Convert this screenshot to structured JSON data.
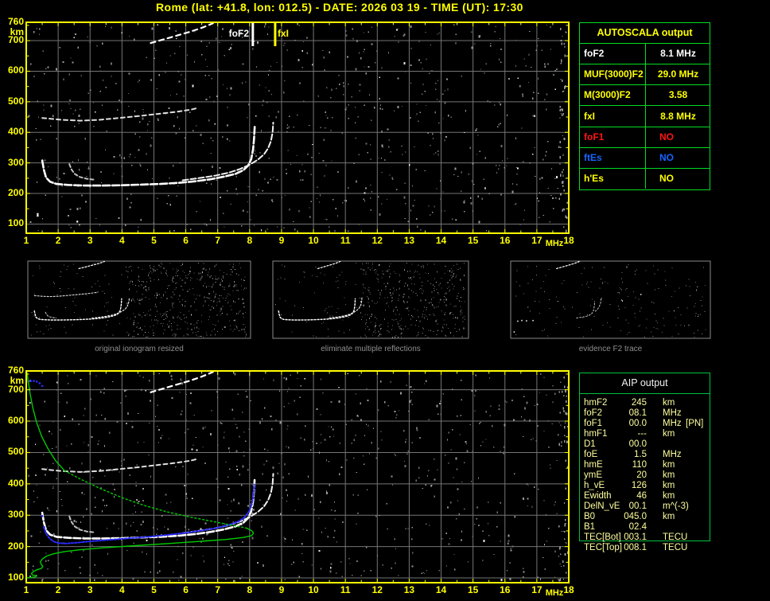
{
  "title": "Rome (lat: +41.8, lon: 012.5) - DATE: 2026 03 19 - TIME (UT): 17:30",
  "colors": {
    "accent_yellow": "#ffff00",
    "grid_gray": "#757575",
    "trace_white": "#ffffff",
    "profile_green": "#00cc00",
    "fit_blue": "#2a2aff",
    "table_green": "#00dd22",
    "aip_green": "#00c040",
    "aip_text": "#ffff9e",
    "caption_gray": "#8f8f8f",
    "alert_red": "#ff1414",
    "alert_blue": "#1565ff"
  },
  "markers": {
    "foF2_label": "foF2",
    "foF2_mhz": 8.1,
    "fxI_label": "fxI",
    "fxI_mhz": 8.8
  },
  "axis": {
    "x_labels": [
      "1",
      "2",
      "3",
      "4",
      "5",
      "6",
      "7",
      "8",
      "9",
      "10",
      "11",
      "12",
      "13",
      "14",
      "15",
      "16",
      "17",
      "18"
    ],
    "x_unit": "MHz",
    "y_labels": [
      "760",
      "km",
      "700",
      "600",
      "500",
      "400",
      "300",
      "200",
      "100"
    ]
  },
  "autoscala_table": {
    "header": "AUTOSCALA output",
    "rows": [
      {
        "label": "foF2",
        "value": "8.1 MHz",
        "color": "#ffffff",
        "value_align": "center"
      },
      {
        "label": "MUF(3000)F2",
        "value": "29.0 MHz",
        "color": "#ffff00",
        "value_align": "center"
      },
      {
        "label": "M(3000)F2",
        "value": "3.58",
        "color": "#ffff00",
        "value_align": "center"
      },
      {
        "label": "fxI",
        "value": "8.8 MHz",
        "color": "#ffff00",
        "value_align": "center"
      },
      {
        "label": "foF1",
        "value": "NO",
        "color": "#ff1414",
        "value_align": "left"
      },
      {
        "label": "ftEs",
        "value": "NO",
        "color": "#1565ff",
        "value_align": "left"
      },
      {
        "label": "h'Es",
        "value": "NO",
        "color": "#ffff00",
        "value_align": "left"
      }
    ]
  },
  "aip_table": {
    "header": "AIP output",
    "rows": [
      {
        "label": "hmF2",
        "value": "245",
        "unit": "km",
        "note": ""
      },
      {
        "label": "foF2",
        "value": "08.1",
        "unit": "MHz",
        "note": ""
      },
      {
        "label": "foF1",
        "value": "00.0",
        "unit": "MHz",
        "note": "[PN]"
      },
      {
        "label": "hmF1",
        "value": "---",
        "unit": "km",
        "note": ""
      },
      {
        "label": "D1",
        "value": "00.0",
        "unit": "",
        "note": ""
      },
      {
        "label": "foE",
        "value": "1.5",
        "unit": "MHz",
        "note": ""
      },
      {
        "label": "hmE",
        "value": "110",
        "unit": "km",
        "note": ""
      },
      {
        "label": "ymE",
        "value": "20",
        "unit": "km",
        "note": ""
      },
      {
        "label": "h_vE",
        "value": "126",
        "unit": "km",
        "note": ""
      },
      {
        "label": "Ewidth",
        "value": "46",
        "unit": "km",
        "note": ""
      },
      {
        "label": "DelN_vE",
        "value": "00.1",
        "unit": "m^(-3)",
        "note": ""
      },
      {
        "label": "B0",
        "value": "045.0",
        "unit": "km",
        "note": ""
      },
      {
        "label": "B1",
        "value": "02.4",
        "unit": "",
        "note": ""
      },
      {
        "label": "TEC[Bot]",
        "value": "003.1",
        "unit": "TECU",
        "note": ""
      },
      {
        "label": "TEC[Top]",
        "value": "008.1",
        "unit": "TECU",
        "note": ""
      }
    ]
  },
  "thumbnails": [
    {
      "caption": "original ionogram resized"
    },
    {
      "caption": "eliminate multiple reflections"
    },
    {
      "caption": "evidence F2 trace"
    }
  ],
  "chart_data": {
    "type": "scatter",
    "charts": [
      {
        "name": "autoscala_scaled_ionogram",
        "xlabel": "MHz",
        "ylabel": "km",
        "xlim": [
          1,
          18
        ],
        "ylim": [
          70,
          760
        ],
        "x_ticks": [
          1,
          2,
          3,
          4,
          5,
          6,
          7,
          8,
          9,
          10,
          11,
          12,
          13,
          14,
          15,
          16,
          17,
          18
        ],
        "y_ticks": [
          100,
          200,
          300,
          400,
          500,
          600,
          700,
          760
        ],
        "grid": true,
        "markers": [
          {
            "label": "foF2",
            "x_mhz": 8.1
          },
          {
            "label": "fxI",
            "x_mhz": 8.8
          }
        ],
        "traces": [
          "F2_O_trace",
          "F2_left_arc",
          "F2_X_trace",
          "second_reflection",
          "oblique_trace",
          "stray_dots"
        ]
      },
      {
        "name": "aip_ionogram_with_profile",
        "xlabel": "MHz",
        "ylabel": "km",
        "xlim": [
          1,
          18
        ],
        "ylim": [
          70,
          760
        ],
        "x_ticks": [
          1,
          2,
          3,
          4,
          5,
          6,
          7,
          8,
          9,
          10,
          11,
          12,
          13,
          14,
          15,
          16,
          17,
          18
        ],
        "y_ticks": [
          100,
          200,
          300,
          400,
          500,
          600,
          700,
          760
        ],
        "grid": true,
        "markers": [],
        "traces": [
          "F2_O_trace",
          "F2_left_arc",
          "F2_X_trace",
          "second_reflection",
          "oblique_trace",
          "fitted_trace",
          "fitted_E_dots",
          "profile_topside_solid",
          "profile_topside_dotted",
          "profile_bottomside"
        ]
      }
    ],
    "trace_library": {
      "F2_O_trace": {
        "color": "#ffffff",
        "width": 2.6,
        "dash": "9,3",
        "points_mhz_km": [
          [
            1.5,
            308
          ],
          [
            1.55,
            278
          ],
          [
            1.62,
            252
          ],
          [
            1.75,
            238
          ],
          [
            1.95,
            231
          ],
          [
            2.3,
            228
          ],
          [
            2.8,
            226
          ],
          [
            3.4,
            226
          ],
          [
            4.0,
            227
          ],
          [
            4.6,
            229
          ],
          [
            5.2,
            231
          ],
          [
            5.8,
            235
          ],
          [
            6.3,
            240
          ],
          [
            6.8,
            247
          ],
          [
            7.2,
            255
          ],
          [
            7.55,
            264
          ],
          [
            7.8,
            276
          ],
          [
            7.95,
            291
          ],
          [
            8.05,
            312
          ],
          [
            8.11,
            345
          ],
          [
            8.14,
            380
          ],
          [
            8.16,
            418
          ]
        ]
      },
      "F2_left_arc": {
        "color": "#c0c0c0",
        "width": 2,
        "dash": "4,3",
        "points_mhz_km": [
          [
            2.35,
            296
          ],
          [
            2.42,
            278
          ],
          [
            2.52,
            264
          ],
          [
            2.68,
            254
          ],
          [
            2.9,
            248
          ],
          [
            3.15,
            245
          ]
        ]
      },
      "F2_X_trace": {
        "color": "#f2f2f2",
        "width": 2,
        "dash": "7,3",
        "points_mhz_km": [
          [
            5.9,
            243
          ],
          [
            6.4,
            250
          ],
          [
            6.9,
            258
          ],
          [
            7.35,
            268
          ],
          [
            7.7,
            280
          ],
          [
            8.0,
            294
          ],
          [
            8.25,
            310
          ],
          [
            8.45,
            328
          ],
          [
            8.58,
            348
          ],
          [
            8.67,
            372
          ],
          [
            8.72,
            400
          ],
          [
            8.74,
            432
          ]
        ]
      },
      "second_reflection": {
        "color": "#dedede",
        "width": 2,
        "dash": "5,4",
        "points_mhz_km": [
          [
            1.5,
            447
          ],
          [
            2.1,
            441
          ],
          [
            2.7,
            438
          ],
          [
            3.3,
            441
          ],
          [
            3.9,
            447
          ],
          [
            4.5,
            453
          ],
          [
            5.1,
            460
          ],
          [
            5.7,
            467
          ],
          [
            6.15,
            474
          ],
          [
            6.35,
            479
          ]
        ]
      },
      "oblique_trace": {
        "color": "#ffffff",
        "width": 2.2,
        "dash": "6,5",
        "points_mhz_km": [
          [
            4.9,
            692
          ],
          [
            5.3,
            704
          ],
          [
            5.7,
            716
          ],
          [
            6.1,
            728
          ],
          [
            6.45,
            740
          ],
          [
            6.7,
            750
          ],
          [
            6.85,
            757
          ]
        ]
      },
      "profile_topside_solid": {
        "color": "#00cc00",
        "width": 1.4,
        "dash": "",
        "points_mhz_km": [
          [
            1.02,
            758
          ],
          [
            1.06,
            728
          ],
          [
            1.12,
            688
          ],
          [
            1.2,
            645
          ],
          [
            1.32,
            598
          ],
          [
            1.48,
            552
          ],
          [
            1.68,
            512
          ],
          [
            1.92,
            474
          ],
          [
            2.2,
            442
          ]
        ]
      },
      "profile_topside_dotted": {
        "color": "#00cc00",
        "width": 1.4,
        "dash": "2,3",
        "points_mhz_km": [
          [
            2.2,
            442
          ],
          [
            2.7,
            415
          ],
          [
            3.3,
            386
          ],
          [
            4.0,
            356
          ],
          [
            4.7,
            331
          ],
          [
            5.4,
            311
          ],
          [
            6.1,
            295
          ],
          [
            6.8,
            281
          ],
          [
            7.4,
            269
          ],
          [
            7.9,
            259
          ]
        ]
      },
      "profile_bottomside": {
        "color": "#00cc00",
        "width": 1.4,
        "dash": "",
        "points_mhz_km": [
          [
            7.9,
            259
          ],
          [
            8.07,
            250
          ],
          [
            8.12,
            243
          ],
          [
            8.06,
            235
          ],
          [
            7.8,
            229
          ],
          [
            7.3,
            223
          ],
          [
            6.5,
            217
          ],
          [
            5.5,
            210
          ],
          [
            4.4,
            203
          ],
          [
            3.4,
            196
          ],
          [
            2.7,
            190
          ],
          [
            2.2,
            184
          ],
          [
            1.85,
            177
          ],
          [
            1.62,
            169
          ],
          [
            1.5,
            160
          ],
          [
            1.44,
            151
          ],
          [
            1.47,
            143
          ],
          [
            1.52,
            137
          ],
          [
            1.47,
            130
          ],
          [
            1.33,
            126
          ],
          [
            1.22,
            120
          ],
          [
            1.16,
            114
          ],
          [
            1.2,
            109
          ],
          [
            1.32,
            107
          ],
          [
            1.28,
            103
          ],
          [
            1.12,
            101
          ],
          [
            1.04,
            100
          ]
        ]
      },
      "fitted_trace": {
        "color": "#2a2aff",
        "width": 2,
        "dash": "2.5,2",
        "points_mhz_km": [
          [
            1.55,
            262
          ],
          [
            1.63,
            240
          ],
          [
            1.73,
            226
          ],
          [
            1.86,
            216
          ],
          [
            2.02,
            211
          ],
          [
            2.25,
            210
          ],
          [
            2.55,
            212
          ],
          [
            2.95,
            216
          ],
          [
            3.4,
            220
          ],
          [
            3.9,
            224
          ],
          [
            4.4,
            228
          ],
          [
            4.95,
            232
          ],
          [
            5.5,
            238
          ],
          [
            6.0,
            244
          ],
          [
            6.5,
            251
          ],
          [
            6.95,
            259
          ],
          [
            7.35,
            269
          ],
          [
            7.65,
            280
          ],
          [
            7.85,
            294
          ],
          [
            7.98,
            312
          ],
          [
            8.07,
            335
          ],
          [
            8.12,
            362
          ],
          [
            8.15,
            398
          ]
        ]
      },
      "fitted_E_dots": {
        "color": "#2a2aff",
        "style": "dots",
        "size": 2.4,
        "points_mhz_km": [
          [
            1.06,
            727
          ],
          [
            1.14,
            728
          ],
          [
            1.24,
            728
          ],
          [
            1.33,
            726
          ],
          [
            1.42,
            721
          ],
          [
            1.5,
            712
          ],
          [
            1.5,
            297
          ],
          [
            1.56,
            262
          ]
        ]
      },
      "stray_dots": {
        "color": "#ffffff",
        "style": "dots",
        "size": 2.2,
        "points_mhz_km": [
          [
            1.36,
            133
          ],
          [
            1.36,
            127
          ],
          [
            2.6,
            108
          ]
        ]
      },
      "F2_O_cusp": {
        "color": "#ffffff",
        "width": 1.4,
        "dash": "2,2",
        "points_mhz_km": [
          [
            6.6,
            245
          ],
          [
            7.1,
            252
          ],
          [
            7.5,
            261
          ],
          [
            7.8,
            274
          ],
          [
            7.95,
            290
          ],
          [
            8.05,
            312
          ],
          [
            8.11,
            345
          ],
          [
            8.15,
            395
          ]
        ]
      },
      "F2_X_cusp": {
        "color": "#ffffff",
        "width": 1.4,
        "dash": "2,2",
        "points_mhz_km": [
          [
            8.2,
            305
          ],
          [
            8.4,
            325
          ],
          [
            8.55,
            350
          ],
          [
            8.65,
            380
          ],
          [
            8.7,
            420
          ]
        ]
      },
      "E_specks": {
        "color": "#e8e8e8",
        "style": "dots",
        "size": 1.6,
        "points_mhz_km": [
          [
            1.6,
            215
          ],
          [
            1.95,
            222
          ],
          [
            2.35,
            218
          ],
          [
            2.9,
            221
          ],
          [
            1.3,
            118
          ]
        ]
      }
    },
    "thumbnail_traces": [
      [
        "oblique_trace",
        "second_reflection",
        "F2_O_trace",
        "F2_X_trace",
        "F2_left_arc"
      ],
      [
        "oblique_trace",
        "F2_O_trace",
        "F2_X_trace"
      ],
      [
        "oblique_trace",
        "F2_O_cusp",
        "F2_X_cusp",
        "E_specks"
      ]
    ]
  }
}
